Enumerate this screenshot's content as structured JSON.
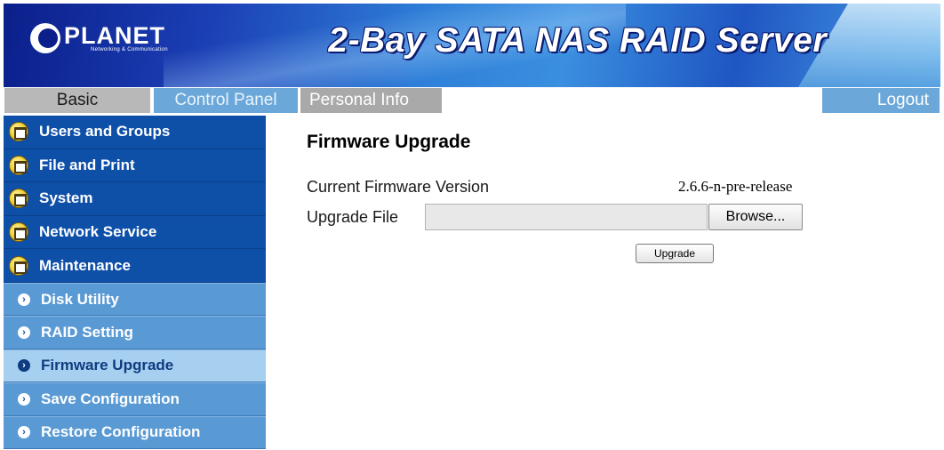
{
  "header": {
    "brand_name": "PLANET",
    "brand_tagline": "Networking & Communication",
    "product_title": "2-Bay SATA NAS RAID Server"
  },
  "tabs": {
    "basic": "Basic",
    "control_panel": "Control Panel",
    "personal_info": "Personal Info",
    "logout": "Logout"
  },
  "sidebar": {
    "categories": [
      {
        "label": "Users and Groups",
        "icon": "folder-icon"
      },
      {
        "label": "File and Print",
        "icon": "folder-icon"
      },
      {
        "label": "System",
        "icon": "folder-icon"
      },
      {
        "label": "Network Service",
        "icon": "folder-icon"
      },
      {
        "label": "Maintenance",
        "icon": "folder-icon"
      }
    ],
    "items": [
      {
        "label": "Disk Utility",
        "icon": "chevron-right-icon",
        "active": false
      },
      {
        "label": "RAID Setting",
        "icon": "chevron-right-icon",
        "active": false
      },
      {
        "label": "Firmware Upgrade",
        "icon": "chevron-right-icon",
        "active": true
      },
      {
        "label": "Save Configuration",
        "icon": "chevron-right-icon",
        "active": false
      },
      {
        "label": "Restore Configuration",
        "icon": "chevron-right-icon",
        "active": false
      }
    ]
  },
  "main": {
    "title": "Firmware Upgrade",
    "current_version_label": "Current Firmware Version",
    "current_version_value": "2.6.6-n-pre-release",
    "upgrade_file_label": "Upgrade File",
    "upgrade_file_value": "",
    "browse_label": "Browse...",
    "upgrade_label": "Upgrade"
  },
  "colors": {
    "brand_dark_blue": "#0e4fa8",
    "sub_menu_blue": "#5a9ad4",
    "active_item": "#a6cff0",
    "tab_active": "#6ba8d9"
  }
}
